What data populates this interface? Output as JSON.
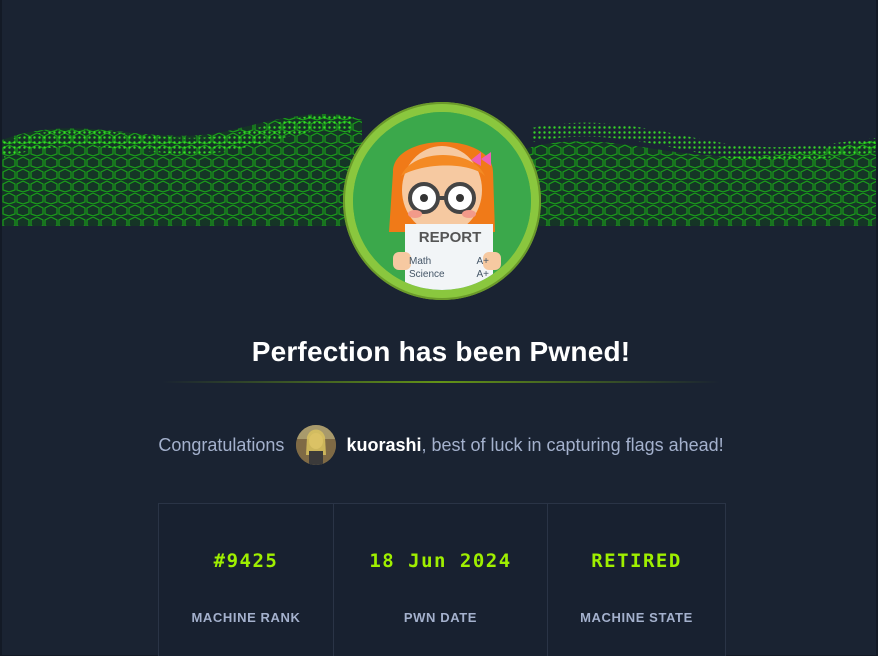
{
  "title": "Perfection has been Pwned!",
  "congrats": {
    "prefix": "Congratulations",
    "username": "kuorashi",
    "suffix": ", best of luck in capturing flags ahead!"
  },
  "avatar_card": {
    "report_label": "REPORT",
    "rows": [
      {
        "subject": "Math",
        "grade": "A+"
      },
      {
        "subject": "Science",
        "grade": "A+"
      }
    ]
  },
  "stats": [
    {
      "value": "#9425",
      "label": "MACHINE RANK"
    },
    {
      "value": "18 Jun 2024",
      "label": "PWN DATE"
    },
    {
      "value": "RETIRED",
      "label": "MACHINE STATE"
    }
  ],
  "colors": {
    "accent": "#9fef00",
    "background": "#1a2332",
    "text_muted": "#a4b1cd",
    "avatar_ring": "#8ac73e"
  }
}
